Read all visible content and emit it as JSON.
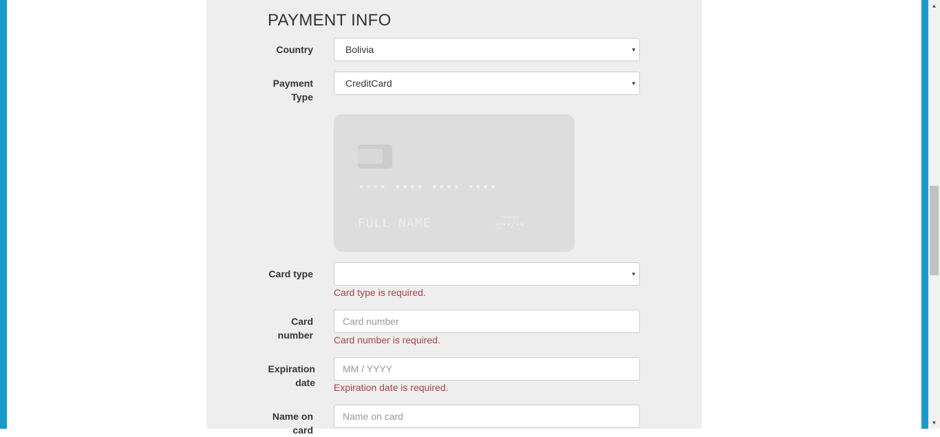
{
  "section": {
    "title": "PAYMENT INFO"
  },
  "fields": {
    "country": {
      "label": "Country",
      "value": "Bolivia"
    },
    "payment_type": {
      "label": "Payment Type",
      "value": "CreditCard"
    },
    "card_type": {
      "label": "Card type",
      "value": "",
      "error": "Card type is required."
    },
    "card_number": {
      "label": "Card number",
      "placeholder": "Card number",
      "value": "",
      "error": "Card number is required."
    },
    "expiration": {
      "label": "Expiration date",
      "placeholder": "MM / YYYY",
      "value": "",
      "error": "Expiration date is required."
    },
    "name_on_card": {
      "label": "Name on card",
      "placeholder": "Name on card",
      "value": ""
    }
  },
  "card_preview": {
    "number": "•••• •••• •••• ••••",
    "name": "FULL NAME",
    "valid_thru": "valid thru",
    "month_year": "month/year",
    "expiry": "••/••"
  },
  "scrollbar": {
    "up_arrow": "▲",
    "down_arrow": "▼"
  },
  "select_caret": "▾",
  "colors": {
    "accent": "#1a9ac9",
    "error": "#a94442",
    "panel": "#eeeeee",
    "card": "#dddddd"
  }
}
